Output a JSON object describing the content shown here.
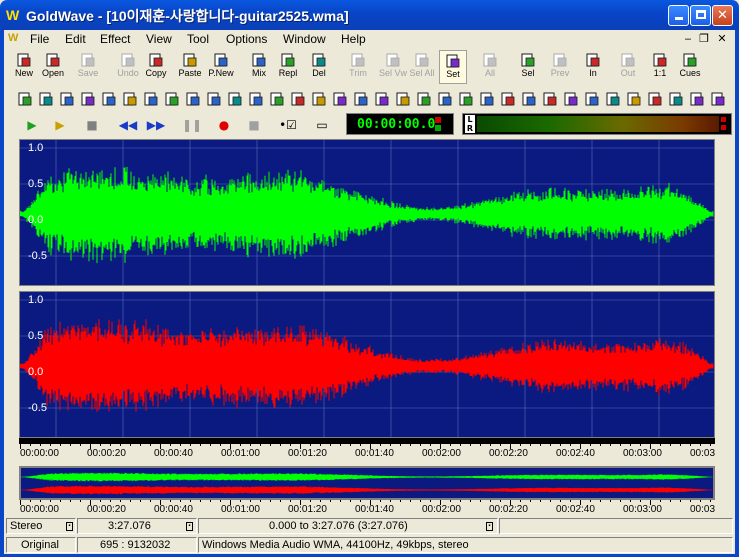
{
  "window": {
    "logo": "W",
    "title": "GoldWave - [10이재훈-사랑합니다-guitar2525.wma]",
    "buttons": [
      "minimize",
      "maximize",
      "close"
    ]
  },
  "menubar": {
    "logo": "W",
    "items": [
      "File",
      "Edit",
      "Effect",
      "View",
      "Tool",
      "Options",
      "Window",
      "Help"
    ],
    "mdi_buttons": [
      "‒",
      "❐",
      "✕"
    ]
  },
  "toolbar_main": {
    "buttons": [
      {
        "label": "New",
        "icon": "new-file-icon",
        "enabled": true
      },
      {
        "label": "Open",
        "icon": "open-folder-icon",
        "enabled": true
      },
      {
        "label": "Save",
        "icon": "save-disk-icon",
        "enabled": false
      },
      {
        "label": "Undo",
        "icon": "undo-icon",
        "enabled": false
      },
      {
        "label": "Copy",
        "icon": "copy-icon",
        "enabled": true
      },
      {
        "label": "Paste",
        "icon": "paste-icon",
        "enabled": true
      },
      {
        "label": "P.New",
        "icon": "paste-new-icon",
        "enabled": true
      },
      {
        "label": "Mix",
        "icon": "mix-icon",
        "enabled": true
      },
      {
        "label": "Repl",
        "icon": "replace-icon",
        "enabled": true
      },
      {
        "label": "Del",
        "icon": "delete-icon",
        "enabled": true
      },
      {
        "label": "Trim",
        "icon": "trim-icon",
        "enabled": false
      },
      {
        "label": "Sel Vw",
        "icon": "select-view-icon",
        "enabled": false
      },
      {
        "label": "Sel All",
        "icon": "select-all-icon",
        "enabled": false
      },
      {
        "label": "Set",
        "icon": "set-icon",
        "enabled": true
      },
      {
        "label": "All",
        "icon": "zoom-all-icon",
        "enabled": false
      },
      {
        "label": "Sel",
        "icon": "zoom-selection-icon",
        "enabled": true
      },
      {
        "label": "Prev",
        "icon": "zoom-previous-icon",
        "enabled": false
      },
      {
        "label": "In",
        "icon": "zoom-in-icon",
        "enabled": true
      },
      {
        "label": "Out",
        "icon": "zoom-out-icon",
        "enabled": false
      },
      {
        "label": "1:1",
        "icon": "zoom-1-1-icon",
        "enabled": true
      },
      {
        "label": "Cues",
        "icon": "cues-icon",
        "enabled": true
      }
    ]
  },
  "toolbar_effects": {
    "icons": [
      "auto-trim-icon",
      "compressor-icon",
      "cue-point-icon",
      "doppler-icon",
      "dynamics-icon",
      "echo-icon",
      "envelope-icon",
      "equalizer-icon",
      "fade-icon",
      "filter-icon",
      "flanger-icon",
      "invert-icon",
      "mechanize-icon",
      "offset-icon",
      "pan-icon",
      "pitch-icon",
      "reverb-icon",
      "reverse-icon",
      "silence-icon",
      "time-warp-icon",
      "volume-icon",
      "noise-reduction-icon",
      "pop-click-icon",
      "resample-icon",
      "match-volume-icon",
      "maximize-volume-icon",
      "shape-volume-icon",
      "playback-rate-icon",
      "channel-mixer-icon",
      "band-pass-icon",
      "low-high-pass-icon",
      "parametric-eq-icon",
      "spectrum-filter-icon",
      "noise-gate-icon"
    ]
  },
  "transport": {
    "icons": [
      "play-icon",
      "play-selection-icon",
      "stop-icon",
      "rewind-icon",
      "fast-forward-icon",
      "pause-icon",
      "record-icon",
      "stop-record-icon",
      "mode-select-icon",
      "window-mode-icon"
    ],
    "time": "00:00:00.0",
    "meter_labels": [
      "L",
      "R"
    ]
  },
  "waveform": {
    "channels": [
      {
        "name": "left",
        "color": "#00ff00",
        "y_labels": [
          "1.0",
          "0.5",
          "0.0",
          "-0.5"
        ]
      },
      {
        "name": "right",
        "color": "#ff0000",
        "y_labels": [
          "1.0",
          "0.5",
          "0.0",
          "-0.5"
        ]
      }
    ],
    "background": "#0a1a80",
    "grid_color": "#5a6ab8"
  },
  "timeline": {
    "labels": [
      "00:00:00",
      "00:00:20",
      "00:00:40",
      "00:01:00",
      "00:01:20",
      "00:01:40",
      "00:02:00",
      "00:02:20",
      "00:02:40",
      "00:03:00",
      "00:03"
    ]
  },
  "overview_timeline": {
    "labels": [
      "00:00:00",
      "00:00:20",
      "00:00:40",
      "00:01:00",
      "00:01:20",
      "00:01:40",
      "00:02:00",
      "00:02:20",
      "00:02:40",
      "00:03:00",
      "00:03"
    ]
  },
  "status1": {
    "channels": "Stereo",
    "length": "3:27.076",
    "selection": "0.000 to 3:27.076 (3:27.076)"
  },
  "status2": {
    "state": "Original",
    "ratio": "695 : 9132032",
    "format": "Windows Media Audio WMA, 44100Hz, 49kbps, stereo"
  }
}
